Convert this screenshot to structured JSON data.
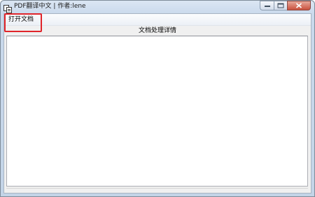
{
  "window": {
    "title": "PDF翻译中文 | 作者:lene"
  },
  "menu": {
    "open_document": "打开文档"
  },
  "main": {
    "section_label": "文档处理详情",
    "details_text": ""
  },
  "icons": {
    "app": "pdf-app-icon",
    "minimize": "minimize-icon",
    "maximize": "maximize-icon",
    "close": "close-icon"
  },
  "colors": {
    "highlight_border": "#e0242a",
    "close_button": "#c9503c"
  }
}
